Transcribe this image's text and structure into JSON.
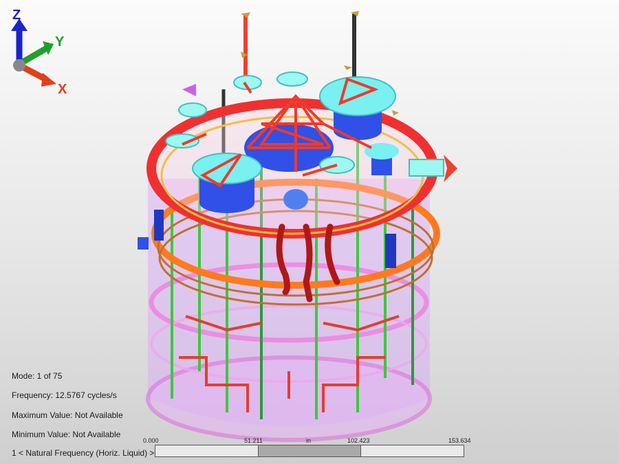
{
  "model_view": {
    "description_icon": "fea-mode-shape-model"
  },
  "info_panel": {
    "mode": "Mode:  1 of 75",
    "frequency": "Frequency: 12.5767 cycles/s",
    "maximum": "Maximum Value: Not Available",
    "minimum": "Minimum Value: Not Available"
  },
  "legend": {
    "label": "1 < Natural Frequency (Horiz. Liquid) >"
  },
  "scale": {
    "tick_0": "0.000",
    "tick_1": "51.211",
    "unit": "in",
    "tick_2": "102.423",
    "tick_3": "153.634"
  },
  "triad": {
    "z": "Z",
    "y": "Y",
    "x": "X",
    "z_color": "#1a24c8",
    "y_color": "#1fa02a",
    "x_color": "#e0401a"
  },
  "colors": {
    "tank_fill": "#c890f0",
    "red_member": "#f03a2a",
    "green_member": "#3cc83c",
    "blue_component": "#3050e8",
    "cyan_component": "#7af0f0",
    "orange_ring": "#ff7a1e",
    "magenta_band": "#f060d8"
  }
}
